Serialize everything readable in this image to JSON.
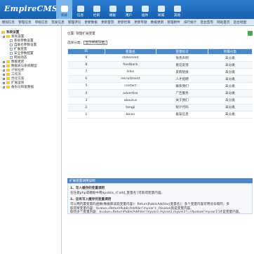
{
  "brand": {
    "logo_text": "EmpireCMS"
  },
  "topnav": [
    {
      "label": "系统",
      "active": true
    },
    {
      "label": "信息",
      "active": false
    },
    {
      "label": "栏目",
      "active": false
    },
    {
      "label": "模板",
      "active": false
    },
    {
      "label": "用户",
      "active": false
    },
    {
      "label": "插件",
      "active": false
    },
    {
      "label": "商城",
      "active": false
    },
    {
      "label": "其他",
      "active": false
    }
  ],
  "subnav": [
    "增加信息",
    "管理信息",
    "审核信息",
    "签发信息",
    "管理评论",
    "更新数据",
    "更新首页",
    "更新栏目",
    "更新专题",
    "数据更新",
    "管理附件",
    "排行统计",
    "后台首页",
    "网站首页",
    "后台地图"
  ],
  "sidebar": [
    {
      "label": "系统设置",
      "level": 0,
      "kind": "folder"
    },
    {
      "label": "系统设置",
      "level": 1,
      "kind": "folder"
    },
    {
      "label": "系统参数设置",
      "level": 2,
      "kind": "page"
    },
    {
      "label": "自助也参数设置",
      "level": 2,
      "kind": "page"
    },
    {
      "label": "扩展变量",
      "level": 2,
      "kind": "page"
    },
    {
      "label": "安全参数配置",
      "level": 2,
      "kind": "page"
    },
    {
      "label": "网站动态",
      "level": 2,
      "kind": "page"
    },
    {
      "label": "数据更新",
      "level": 1,
      "kind": "folder"
    },
    {
      "label": "数据表与系统模型",
      "level": 1,
      "kind": "folder"
    },
    {
      "label": "计划任务",
      "level": 1,
      "kind": "folder"
    },
    {
      "label": "工作流",
      "level": 1,
      "kind": "folder"
    },
    {
      "label": "优化方案",
      "level": 1,
      "kind": "folder"
    },
    {
      "label": "扩展菜单",
      "level": 1,
      "kind": "folder"
    },
    {
      "label": "备份与恢复数据",
      "level": 1,
      "kind": "folder"
    }
  ],
  "main": {
    "breadcrumb": "位置: 管理扩展变量",
    "filter_label": "选择分类:",
    "filter_value": "显示所有分类"
  },
  "table": {
    "headers": [
      "ID",
      "变量名",
      "变量标识",
      "所属分类"
    ],
    "rows": [
      [
        "9",
        "statement",
        "免责声明",
        "未分类"
      ],
      [
        "8",
        "feedback",
        "意见反馈",
        "未分类"
      ],
      [
        "7",
        "links",
        "友情链接",
        "未分类"
      ],
      [
        "6",
        "recruitment",
        "人才招聘",
        "未分类"
      ],
      [
        "5",
        "contact",
        "联系我们",
        "未分类"
      ],
      [
        "4",
        "advertise",
        "广告服务",
        "未分类"
      ],
      [
        "3",
        "aboutus",
        "关于我们",
        "未分类"
      ],
      [
        "2",
        "tongji",
        "统计代码",
        "未分类"
      ],
      [
        "1",
        "beian",
        "备案信息",
        "未分类"
      ]
    ]
  },
  "info": {
    "title": "扩展变量调用说明",
    "line1": "1、写入缓存的变量调用",
    "line2": "在任意php或模板中用$public_r['add_变量名']可取得变量内容。",
    "line3": "2、没有写入缓存的变量调用",
    "line4": "可以用内置变量的函数(数据库读取变量内容)：ReturnPublicAddVar(变量名)；多个变量内容可用逗号隔开，多",
    "line5": "取得单变量内容：$value=ReturnPublicAddVar('myvar'); //$value就是变量内容。",
    "line6": "取得多个变量内容：$value=ReturnPublicAddVar('myvar1,myvar2,myvar3'); //$value['myvar1']才是变量内容。"
  }
}
